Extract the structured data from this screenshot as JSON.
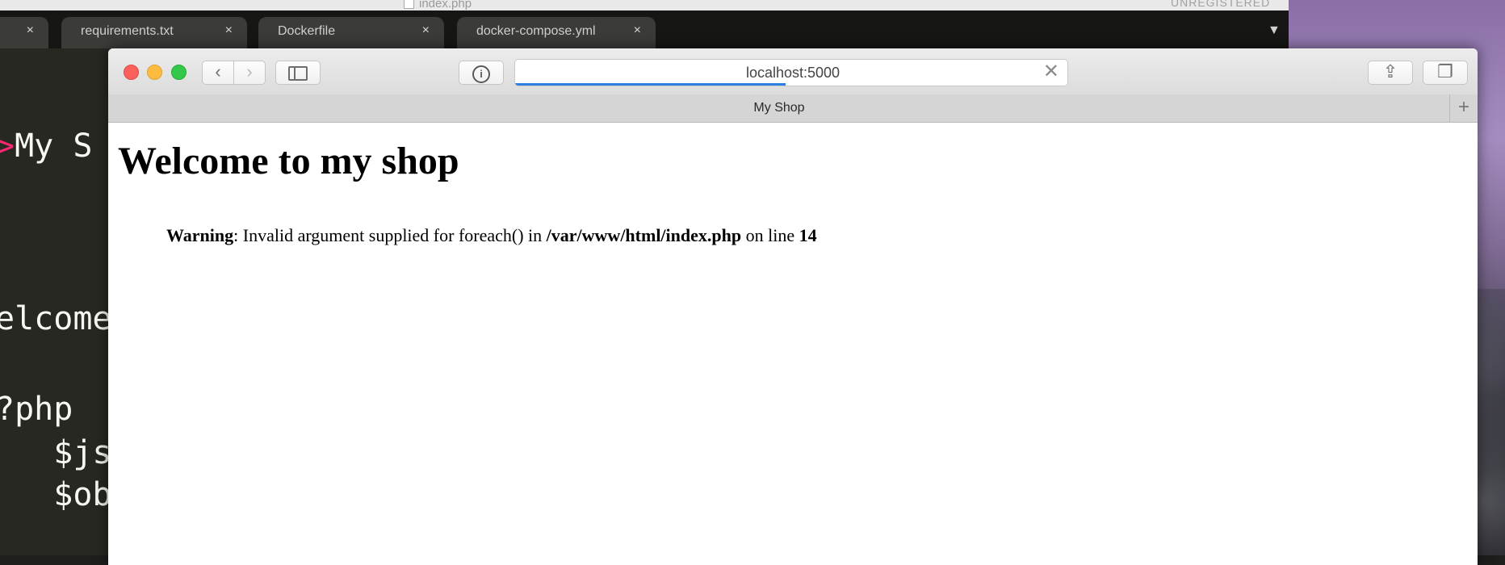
{
  "editor": {
    "window_title": "index.php",
    "license_status": "UNREGISTERED",
    "tabs": [
      {
        "label": ""
      },
      {
        "label": "requirements.txt"
      },
      {
        "label": "Dockerfile"
      },
      {
        "label": "docker-compose.yml"
      }
    ],
    "close_glyph": "×",
    "menu_caret": "▼",
    "code_lines": [
      {
        "prefix": ">",
        "text": "My S"
      },
      {
        "prefix": "",
        "text": "elcome"
      },
      {
        "prefix": "",
        "text": "?php"
      },
      {
        "prefix": "",
        "text": "   $js"
      },
      {
        "prefix": "",
        "text": "   $ob"
      }
    ]
  },
  "browser": {
    "url": "localhost:5000",
    "load_progress": 0.49,
    "tab_title": "My Shop",
    "new_tab_glyph": "+",
    "clear_glyph": "✕",
    "back_glyph": "‹",
    "forward_glyph": "›",
    "reader_glyph": "i",
    "share_glyph": "⇪",
    "tabs_glyph": "❐"
  },
  "page": {
    "heading": "Welcome to my shop",
    "warning": {
      "label": "Warning",
      "message": ": Invalid argument supplied for foreach() in ",
      "file": "/var/www/html/index.php",
      "on_line": " on line ",
      "line": "14"
    }
  },
  "colors": {
    "progress": "#2f7fe0",
    "close_light": "#fc605c",
    "minimize_light": "#fdbc40",
    "maximize_light": "#34c84a",
    "code_tag": "#f92672"
  }
}
